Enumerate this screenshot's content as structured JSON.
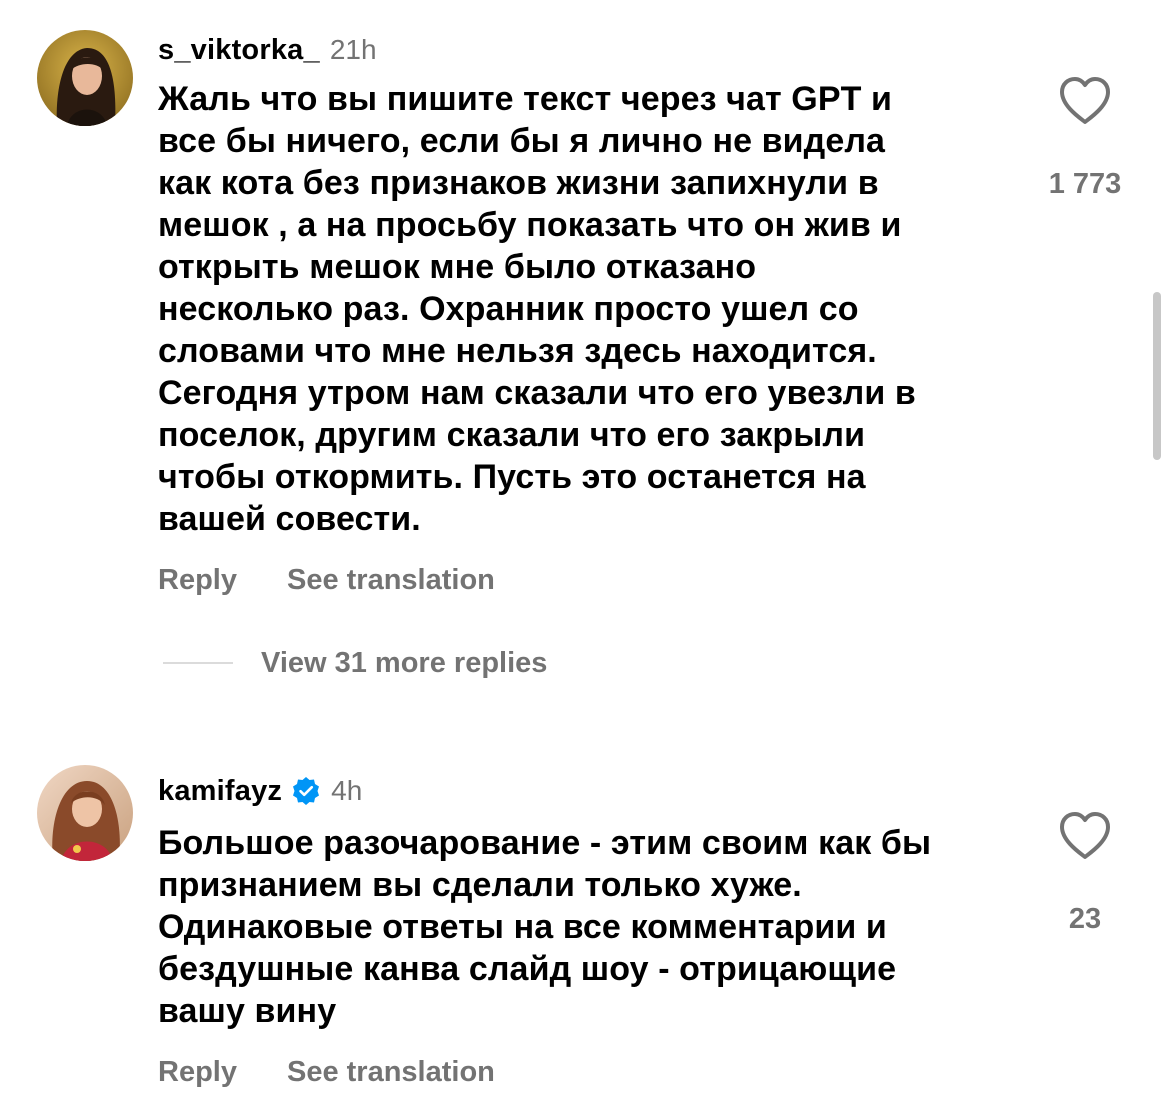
{
  "comments": [
    {
      "username": "s_viktorka_",
      "time": "21h",
      "verified": false,
      "text": "Жаль что вы пишите текст через чат GPT  и\nвсе бы ничего, если бы я лично не видела\nкак кота без признаков жизни запихнули в\nмешок , а на просьбу показать что он жив и\nоткрыть мешок мне было отказано\nнесколько раз. Охранник просто ушел со\nсловами что мне нельзя здесь находится.\nСегодня утром нам сказали что его увезли в\nпоселок, другим сказали что его закрыли\nчтобы откормить. Пусть это останется на\nвашей совести.",
      "like_count": "1 773",
      "reply_label": "Reply",
      "translate_label": "See translation",
      "view_replies_label": "View 31 more replies"
    },
    {
      "username": "kamifayz",
      "time": "4h",
      "verified": true,
      "text": "Большое разочарование - этим своим как бы\nпризнанием вы сделали только хуже.\nОдинаковые ответы на все комментарии и\nбездушные канва слайд шоу - отрицающие\nвашу вину",
      "like_count": "23",
      "reply_label": "Reply",
      "translate_label": "See translation"
    }
  ],
  "colors": {
    "text": "#000000",
    "secondary": "#737373",
    "verified_badge": "#0095f6",
    "divider": "#dbdbdb"
  },
  "icons": {
    "like": "heart-outline-icon",
    "verified": "verified-badge-icon"
  }
}
